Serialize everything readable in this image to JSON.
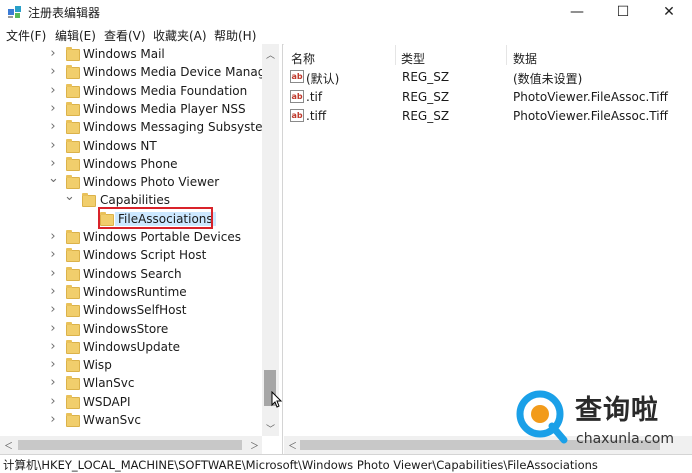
{
  "window": {
    "title": "注册表编辑器",
    "minimize_glyph": "—",
    "maximize_glyph": "☐",
    "close_glyph": "✕"
  },
  "menu": [
    "文件(F)",
    "编辑(E)",
    "查看(V)",
    "收藏夹(A)",
    "帮助(H)"
  ],
  "tree": {
    "items": [
      {
        "label": "Windows Mail",
        "level": 0,
        "state": "collapsed"
      },
      {
        "label": "Windows Media Device Manager",
        "level": 0,
        "state": "collapsed"
      },
      {
        "label": "Windows Media Foundation",
        "level": 0,
        "state": "collapsed"
      },
      {
        "label": "Windows Media Player NSS",
        "level": 0,
        "state": "collapsed"
      },
      {
        "label": "Windows Messaging Subsystem",
        "level": 0,
        "state": "collapsed"
      },
      {
        "label": "Windows NT",
        "level": 0,
        "state": "collapsed"
      },
      {
        "label": "Windows Phone",
        "level": 0,
        "state": "collapsed"
      },
      {
        "label": "Windows Photo Viewer",
        "level": 0,
        "state": "expanded"
      },
      {
        "label": "Capabilities",
        "level": 1,
        "state": "expanded"
      },
      {
        "label": "FileAssociations",
        "level": 2,
        "state": "leaf",
        "selected": true
      },
      {
        "label": "Windows Portable Devices",
        "level": 0,
        "state": "collapsed"
      },
      {
        "label": "Windows Script Host",
        "level": 0,
        "state": "collapsed"
      },
      {
        "label": "Windows Search",
        "level": 0,
        "state": "collapsed"
      },
      {
        "label": "WindowsRuntime",
        "level": 0,
        "state": "collapsed"
      },
      {
        "label": "WindowsSelfHost",
        "level": 0,
        "state": "collapsed"
      },
      {
        "label": "WindowsStore",
        "level": 0,
        "state": "collapsed"
      },
      {
        "label": "WindowsUpdate",
        "level": 0,
        "state": "collapsed"
      },
      {
        "label": "Wisp",
        "level": 0,
        "state": "collapsed"
      },
      {
        "label": "WlanSvc",
        "level": 0,
        "state": "collapsed"
      },
      {
        "label": "WSDAPI",
        "level": 0,
        "state": "collapsed"
      },
      {
        "label": "WwanSvc",
        "level": 0,
        "state": "collapsed"
      }
    ]
  },
  "list": {
    "columns": [
      "名称",
      "类型",
      "数据"
    ],
    "rows": [
      {
        "name": "(默认)",
        "type": "REG_SZ",
        "data": "(数值未设置)"
      },
      {
        "name": ".tif",
        "type": "REG_SZ",
        "data": "PhotoViewer.FileAssoc.Tiff"
      },
      {
        "name": ".tiff",
        "type": "REG_SZ",
        "data": "PhotoViewer.FileAssoc.Tiff"
      }
    ],
    "value_icon": "ab"
  },
  "statusbar": {
    "path": "计算机\\HKEY_LOCAL_MACHINE\\SOFTWARE\\Microsoft\\Windows Photo Viewer\\Capabilities\\FileAssociations"
  },
  "watermark": {
    "brand": "查询啦",
    "url": "chaxunla.com"
  },
  "colors": {
    "folder": "#f1ce6c",
    "selection": "#cce8ff",
    "highlight_box": "#d9232a",
    "watermark_blue": "#1aa0e8",
    "watermark_orange": "#f29b1b"
  }
}
